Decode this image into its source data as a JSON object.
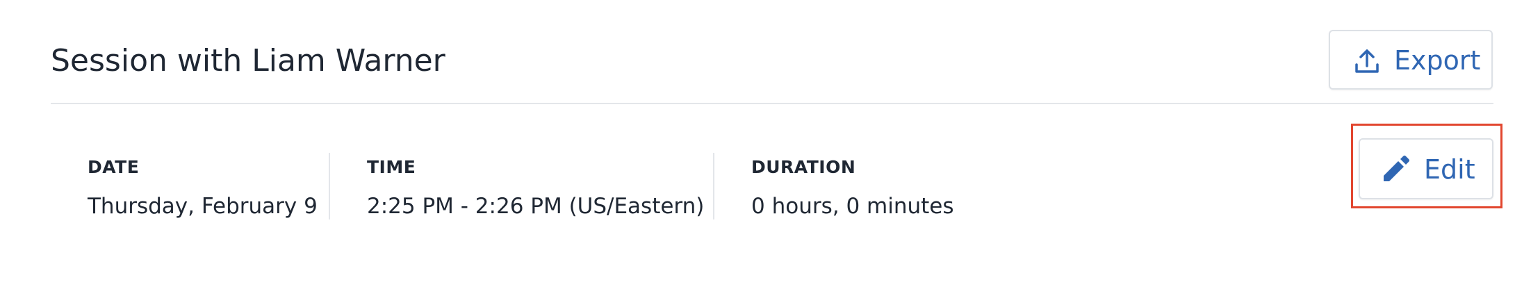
{
  "header": {
    "title": "Session with Liam Warner",
    "export_label": "Export",
    "export_icon": "upload-icon"
  },
  "details": {
    "date": {
      "label": "DATE",
      "value": "Thursday, February 9"
    },
    "time": {
      "label": "TIME",
      "value": "2:25 PM - 2:26 PM (US/Eastern)"
    },
    "duration": {
      "label": "DURATION",
      "value": "0 hours, 0 minutes"
    }
  },
  "actions": {
    "edit_label": "Edit",
    "edit_icon": "pencil-icon"
  },
  "colors": {
    "accent": "#2f66b3",
    "text": "#1f2733",
    "border": "#dde1e6",
    "highlight": "#e2462f"
  }
}
